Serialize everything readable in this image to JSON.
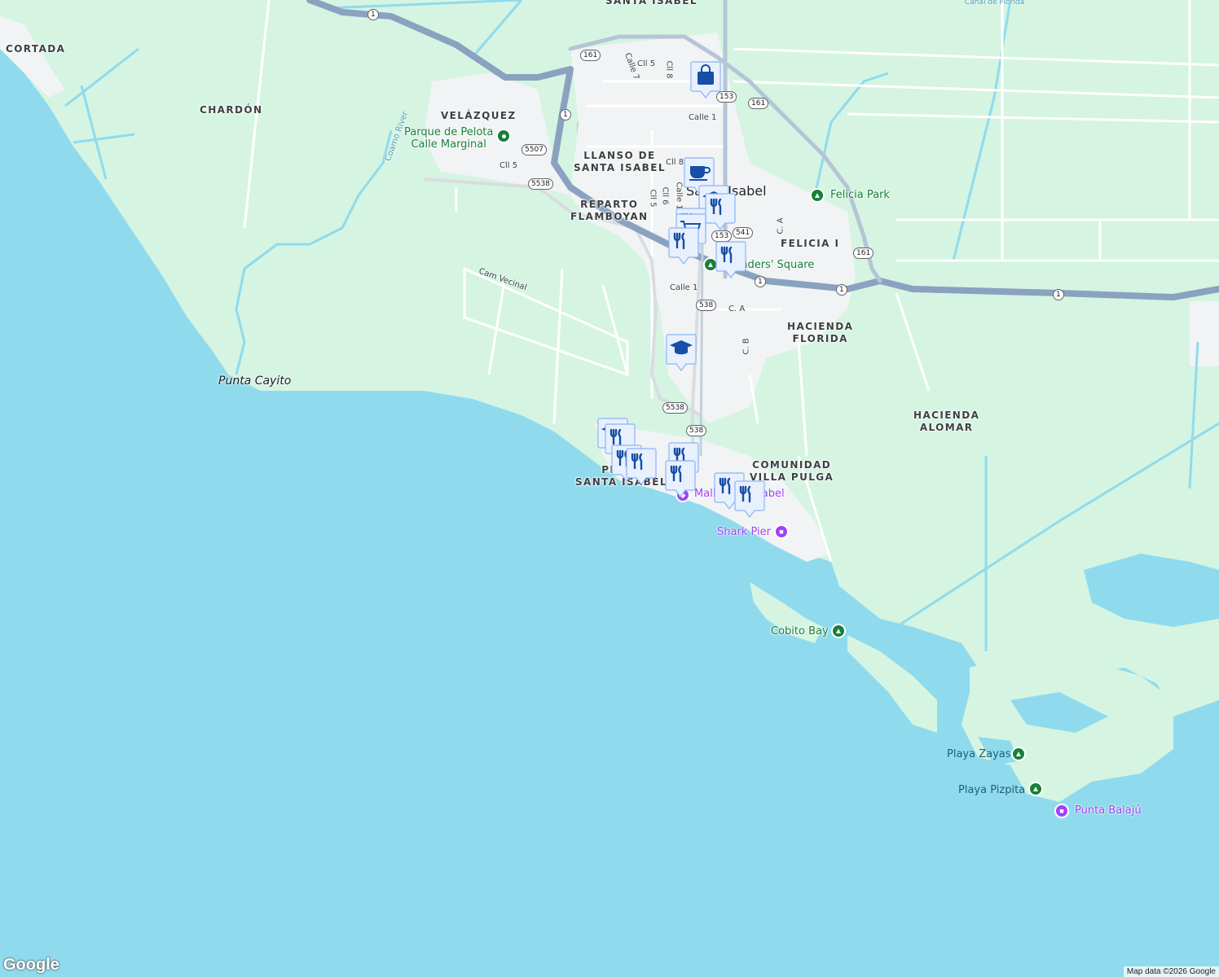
{
  "map": {
    "colors": {
      "water": "#8fdbed",
      "land": "#d5f4e2",
      "highway": "#8aa2c0",
      "road": "#ffffff",
      "urban": "#f1f3f4",
      "park": "#a8dab5",
      "marker_bg": "#e8f0fe",
      "marker_icon": "#174ea6"
    },
    "areas": [
      {
        "key": "santa_isabel_top",
        "text": "SANTA ISABEL"
      },
      {
        "key": "cortada",
        "text": "CORTADA"
      },
      {
        "key": "chardon",
        "text": "CHARDÓN"
      },
      {
        "key": "velazquez",
        "text": "VELÁZQUEZ"
      },
      {
        "key": "llanso",
        "text": "LLANSO DE\nSANTA ISABEL"
      },
      {
        "key": "reparto",
        "text": "REPARTO\nFLAMBOYAN"
      },
      {
        "key": "felicia",
        "text": "FELICIA I"
      },
      {
        "key": "hacienda_florida",
        "text": "HACIENDA\nFLORIDA"
      },
      {
        "key": "hacienda_alomar",
        "text": "HACIENDA\nALOMAR"
      },
      {
        "key": "comunidad",
        "text": "COMUNIDAD\nVILLA PULGA"
      },
      {
        "key": "playa_si",
        "text": "PLAYA\nSANTA ISABEL"
      }
    ],
    "town": "Santa Isabel",
    "streets": [
      "Cll 5",
      "Cll 8",
      "Calle 7",
      "Calle 1",
      "Cll 8",
      "Cll 6",
      "Cll 5",
      "Calle 1",
      "Calle 1",
      "C. A",
      "C. A",
      "C. B",
      "Cll 5",
      "Cam Vecinal",
      "Coamo River",
      "Canal de Florida"
    ],
    "shields": [
      "1",
      "161",
      "1",
      "153",
      "161",
      "5507",
      "5538",
      "153",
      "541",
      "1",
      "1",
      "161",
      "1",
      "538",
      "5538",
      "538"
    ],
    "places": {
      "parque": "Parque de Pelota\nCalle Marginal",
      "felicia_park": "Felicia Park",
      "founders": "Founders' Square",
      "mall": "Mall Santa Isabel",
      "shark_pier": "Shark Pier",
      "cobito_bay": "Cobito Bay",
      "playa_zayas": "Playa Zayas",
      "playa_pizpita": "Playa Pizpita",
      "punta_balaju": "Punta Balajú",
      "punta_cayito": "Punta Cayito"
    },
    "markers": [
      "shopping-bag-icon",
      "coffee-icon",
      "school-icon",
      "restaurant-icon",
      "restaurant-icon",
      "shopping-cart-icon",
      "restaurant-icon",
      "restaurant-icon",
      "school-icon",
      "school-icon",
      "restaurant-icon",
      "restaurant-icon",
      "restaurant-icon",
      "restaurant-icon",
      "restaurant-icon",
      "restaurant-icon",
      "restaurant-icon"
    ],
    "attribution": "Map data ©2026 Google",
    "logo": "Google"
  }
}
